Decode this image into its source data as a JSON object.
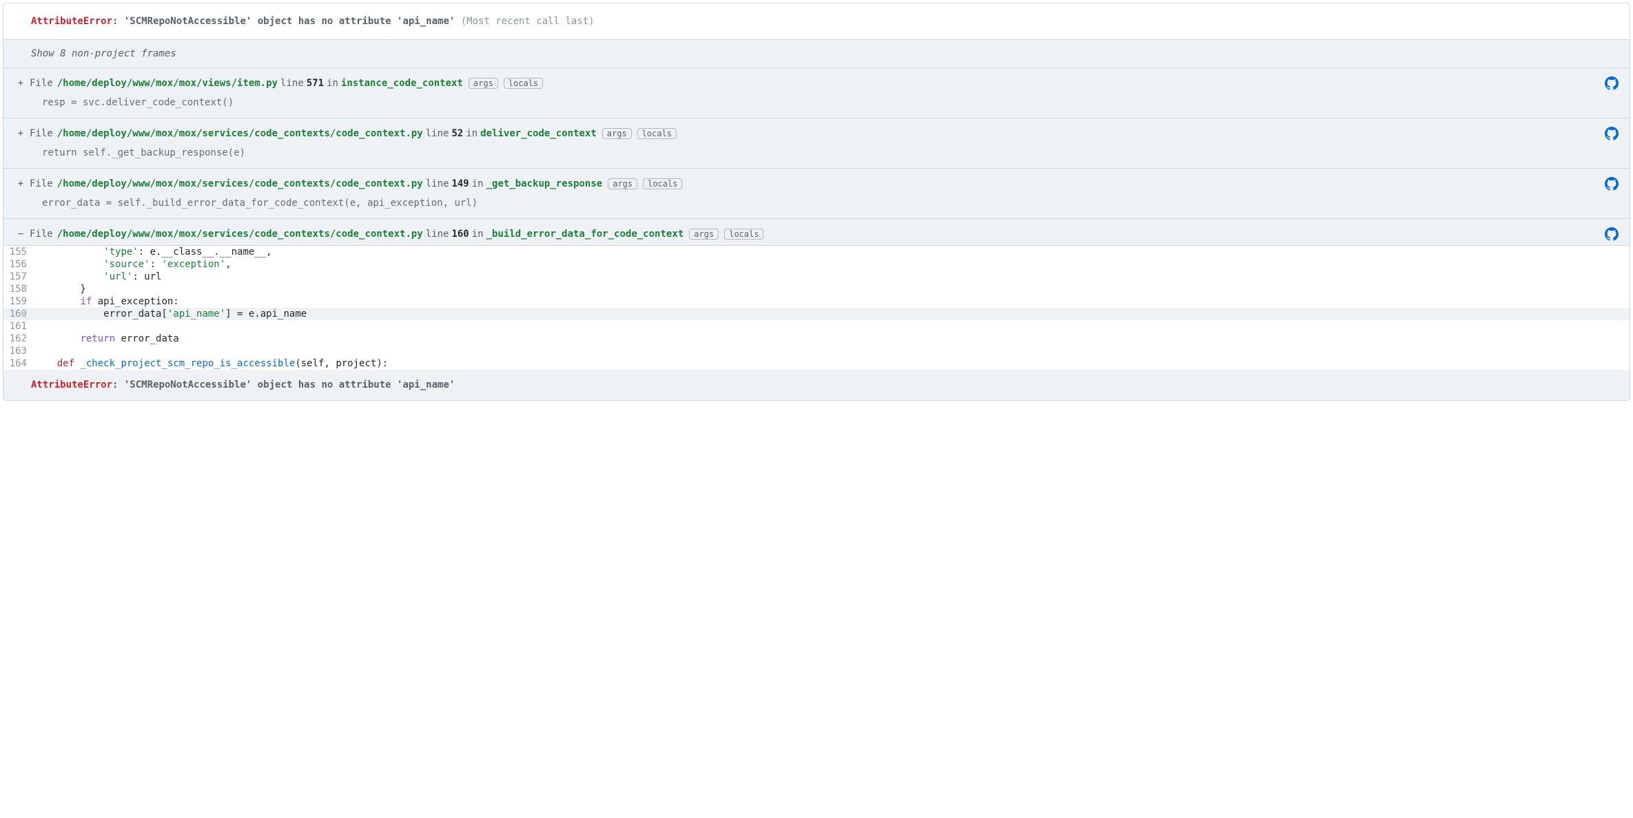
{
  "error": {
    "type": "AttributeError",
    "message": ": 'SCMRepoNotAccessible' object has no attribute 'api_name'",
    "note": "(Most recent call last)"
  },
  "show_hidden_label": "Show 8 non-project frames",
  "labels": {
    "file": "File",
    "line": "line",
    "in": "in",
    "args": "args",
    "locals": "locals",
    "plus": "+",
    "minus": "−"
  },
  "frames": [
    {
      "expanded": false,
      "path": "/home/deploy/www/mox/mox/views/item.py",
      "line": "571",
      "function": "instance_code_context",
      "snippet": "resp = svc.deliver_code_context()"
    },
    {
      "expanded": false,
      "path": "/home/deploy/www/mox/mox/services/code_contexts/code_context.py",
      "line": "52",
      "function": "deliver_code_context",
      "snippet": "return self._get_backup_response(e)"
    },
    {
      "expanded": false,
      "path": "/home/deploy/www/mox/mox/services/code_contexts/code_context.py",
      "line": "149",
      "function": "_get_backup_response",
      "snippet": "error_data = self._build_error_data_for_code_context(e, api_exception, url)"
    },
    {
      "expanded": true,
      "path": "/home/deploy/www/mox/mox/services/code_contexts/code_context.py",
      "line": "160",
      "function": "_build_error_data_for_code_context",
      "code_lines": [
        {
          "n": "155",
          "hl": false,
          "html": "            <span class='tok-str'>'type'</span>: e.__class__.__name__,"
        },
        {
          "n": "156",
          "hl": false,
          "html": "            <span class='tok-str'>'source'</span>: <span class='tok-str'>'exception'</span>,"
        },
        {
          "n": "157",
          "hl": false,
          "html": "            <span class='tok-str'>'url'</span>: url"
        },
        {
          "n": "158",
          "hl": false,
          "html": "        }"
        },
        {
          "n": "159",
          "hl": false,
          "html": "        <span class='tok-kw'>if</span> api_exception:"
        },
        {
          "n": "160",
          "hl": true,
          "html": "            error_data[<span class='tok-str'>'api_name'</span>] = e.api_name"
        },
        {
          "n": "161",
          "hl": false,
          "html": ""
        },
        {
          "n": "162",
          "hl": false,
          "html": "        <span class='tok-kw'>return</span> error_data"
        },
        {
          "n": "163",
          "hl": false,
          "html": ""
        },
        {
          "n": "164",
          "hl": false,
          "html": "    <span class='tok-def'>def</span> <span class='tok-fn'>_check_project_scm_repo_is_accessible</span>(self, project):"
        }
      ]
    }
  ],
  "footer_error": {
    "type": "AttributeError",
    "message": ": 'SCMRepoNotAccessible' object has no attribute 'api_name'"
  }
}
